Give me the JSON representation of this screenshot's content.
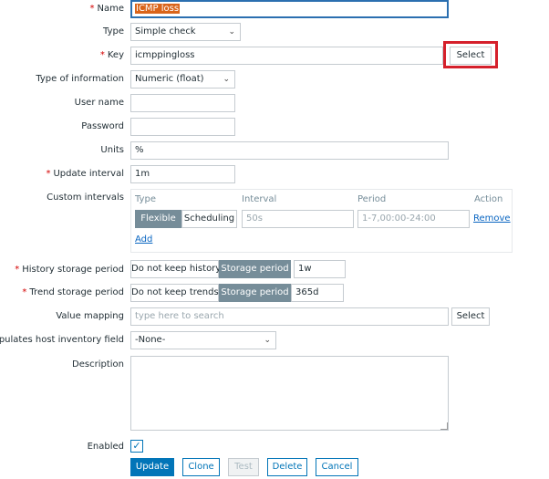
{
  "form": {
    "name": {
      "label": "Name",
      "value": "ICMP loss"
    },
    "type": {
      "label": "Type",
      "value": "Simple check"
    },
    "key": {
      "label": "Key",
      "value": "icmppingloss",
      "button": "Select"
    },
    "type_of_information": {
      "label": "Type of information",
      "value": "Numeric (float)"
    },
    "user_name": {
      "label": "User name",
      "value": ""
    },
    "password": {
      "label": "Password",
      "value": ""
    },
    "units": {
      "label": "Units",
      "value": "%"
    },
    "update_interval": {
      "label": "Update interval",
      "value": "1m"
    },
    "custom_intervals": {
      "label": "Custom intervals",
      "headers": [
        "Type",
        "Interval",
        "Period",
        "Action"
      ],
      "row": {
        "mode_options": [
          "Flexible",
          "Scheduling"
        ],
        "selected_mode": "Flexible",
        "interval_placeholder": "50s",
        "period_placeholder": "1-7,00:00-24:00",
        "action": "Remove"
      },
      "add": "Add"
    },
    "history": {
      "label": "History storage period",
      "options": [
        "Do not keep history",
        "Storage period"
      ],
      "selected": "Storage period",
      "value": "1w"
    },
    "trend": {
      "label": "Trend storage period",
      "options": [
        "Do not keep trends",
        "Storage period"
      ],
      "selected": "Storage period",
      "value": "365d"
    },
    "value_mapping": {
      "label": "Value mapping",
      "placeholder": "type here to search",
      "button": "Select"
    },
    "inventory": {
      "label": "Populates host inventory field",
      "value": "-None-"
    },
    "description": {
      "label": "Description",
      "value": ""
    },
    "enabled": {
      "label": "Enabled",
      "checked": true
    }
  },
  "actions": {
    "update": "Update",
    "clone": "Clone",
    "test": "Test",
    "delete": "Delete",
    "cancel": "Cancel"
  },
  "colors": {
    "accent": "#0275b8",
    "highlight": "#d5202b",
    "required": "#d40000"
  },
  "icons": {
    "chevron": "chevron-down-icon",
    "check": "checkmark-icon"
  }
}
